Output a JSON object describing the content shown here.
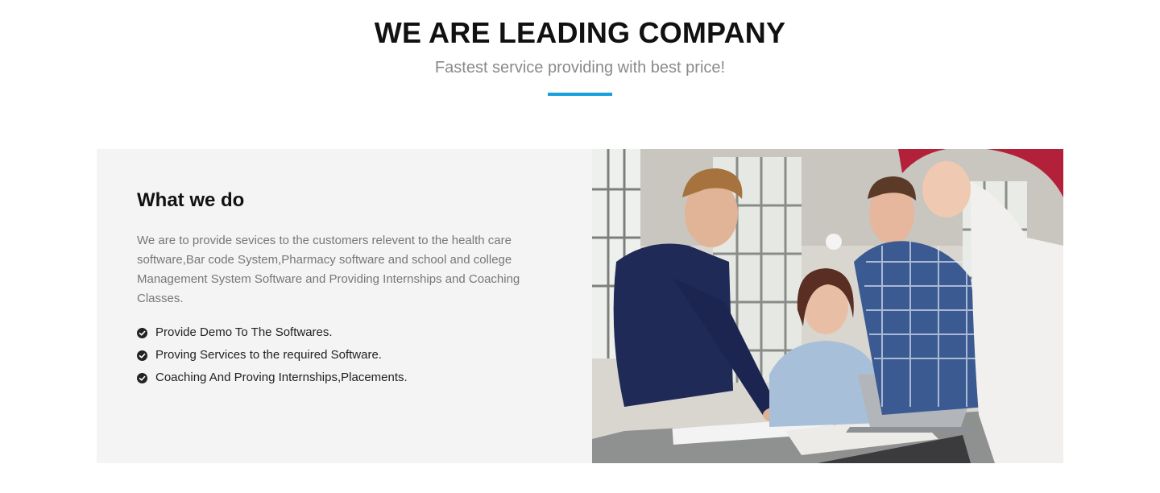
{
  "header": {
    "title": "WE ARE LEADING COMPANY",
    "subtitle": "Fastest service providing with best price!",
    "accent_color": "#1a9fdc"
  },
  "about": {
    "title": "What we do",
    "description": "We are to provide sevices to the customers relevent to the health care software,Bar code System,Pharmacy software and school and college Management System Software and Providing Internships and Coaching Classes.",
    "features": [
      "Provide Demo To The Softwares.",
      "Proving Services to the required Software.",
      "Coaching And Proving Internships,Placements."
    ],
    "feature_icon": "check-circle-icon"
  },
  "image": {
    "subject": "team-meeting-photo"
  }
}
